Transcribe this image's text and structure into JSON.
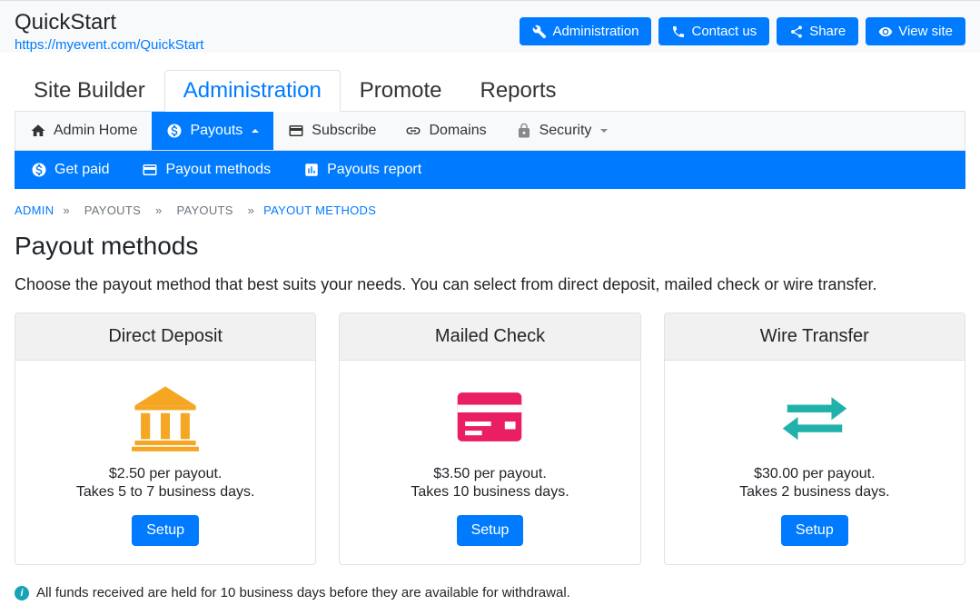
{
  "header": {
    "site_title": "QuickStart",
    "site_url": "https://myevent.com/QuickStart",
    "buttons": {
      "administration": "Administration",
      "contact_us": "Contact us",
      "share": "Share",
      "view_site": "View site"
    }
  },
  "main_tabs": {
    "site_builder": "Site Builder",
    "administration": "Administration",
    "promote": "Promote",
    "reports": "Reports"
  },
  "sub_nav": {
    "admin_home": "Admin Home",
    "payouts": "Payouts",
    "subscribe": "Subscribe",
    "domains": "Domains",
    "security": "Security"
  },
  "tertiary_nav": {
    "get_paid": "Get paid",
    "payout_methods": "Payout methods",
    "payouts_report": "Payouts report"
  },
  "breadcrumb": {
    "admin": "ADMIN",
    "payouts1": "PAYOUTS",
    "payouts2": "PAYOUTS",
    "payout_methods": "PAYOUT METHODS",
    "sep": "»"
  },
  "page": {
    "title": "Payout methods",
    "description": "Choose the payout method that best suits your needs. You can select from direct deposit, mailed check or wire transfer."
  },
  "cards": [
    {
      "title": "Direct Deposit",
      "price": "$2.50 per payout.",
      "timing": "Takes 5 to 7 business days.",
      "setup_label": "Setup"
    },
    {
      "title": "Mailed Check",
      "price": "$3.50 per payout.",
      "timing": "Takes 10 business days.",
      "setup_label": "Setup"
    },
    {
      "title": "Wire Transfer",
      "price": "$30.00 per payout.",
      "timing": "Takes 2 business days.",
      "setup_label": "Setup"
    }
  ],
  "footer_note": "All funds received are held for 10 business days before they are available for withdrawal."
}
